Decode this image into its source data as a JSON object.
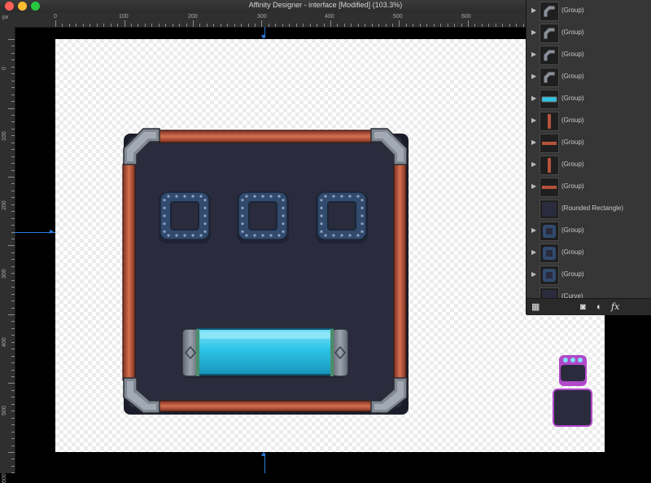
{
  "window": {
    "title": "Affinity Designer - interface [Modified] (103.3%)"
  },
  "ruler": {
    "units": "px",
    "top_ticks": [
      "0",
      "100",
      "200",
      "300",
      "400",
      "500",
      "600"
    ],
    "left_ticks": [
      "0",
      "100",
      "200",
      "300",
      "400",
      "500",
      "600"
    ]
  },
  "layers": {
    "items": [
      {
        "name": "(Group)",
        "thumb": "pipe-corner-icon"
      },
      {
        "name": "(Group)",
        "thumb": "pipe-corner-icon"
      },
      {
        "name": "(Group)",
        "thumb": "pipe-corner-icon"
      },
      {
        "name": "(Group)",
        "thumb": "pipe-corner-icon"
      },
      {
        "name": "(Group)",
        "thumb": "bar-icon"
      },
      {
        "name": "(Group)",
        "thumb": "vertical-rail-icon"
      },
      {
        "name": "(Group)",
        "thumb": "horizontal-rail-icon"
      },
      {
        "name": "(Group)",
        "thumb": "vertical-rail-icon"
      },
      {
        "name": "(Group)",
        "thumb": "horizontal-rail-icon"
      },
      {
        "name": "(Rounded Rectangle)",
        "thumb": "rounded-rect-icon"
      },
      {
        "name": "(Group)",
        "thumb": "slot-icon"
      },
      {
        "name": "(Group)",
        "thumb": "slot-icon"
      },
      {
        "name": "(Group)",
        "thumb": "slot-icon"
      },
      {
        "name": "(Curve)",
        "thumb": "curve-icon"
      }
    ],
    "footer_icons": [
      "layers-stack-icon",
      "mask-icon",
      "adjustment-icon",
      "fx-icon"
    ],
    "fx_label": "fx"
  },
  "colors": {
    "panel": "#2a2b3d",
    "copper": "#b4533a",
    "metal": "#7d8590",
    "bar": "#2ec4e6",
    "slot": "#314a6e",
    "accent_purple": "#b048c8",
    "guide": "#2d7de0"
  }
}
